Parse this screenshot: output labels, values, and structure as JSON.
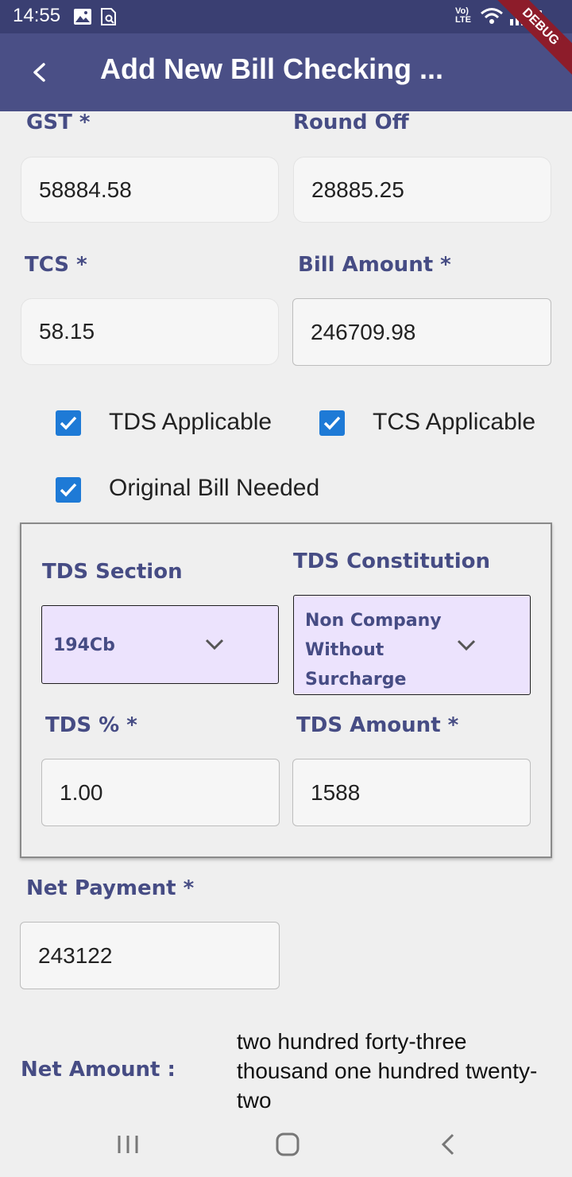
{
  "status_bar": {
    "time": "14:55",
    "network_label": "Vo) LTE"
  },
  "app_bar": {
    "title": "Add New Bill Checking ...",
    "debug_banner": "DEBUG"
  },
  "fields": {
    "gst": {
      "label": "GST *",
      "value": "58884.58"
    },
    "round_off": {
      "label": "Round Off",
      "value": "28885.25"
    },
    "tcs": {
      "label": "TCS *",
      "value": "58.15"
    },
    "bill_amount": {
      "label": "Bill Amount *",
      "value": "246709.98"
    }
  },
  "checkboxes": {
    "tds_applicable": {
      "label": "TDS Applicable",
      "checked": true
    },
    "tcs_applicable": {
      "label": "TCS Applicable",
      "checked": true
    },
    "original_bill": {
      "label": "Original Bill Needed",
      "checked": true
    }
  },
  "tds": {
    "section_label": "TDS Section",
    "section_value": "194Cb",
    "constitution_label": "TDS Constitution",
    "constitution_value": "Non Company Without Surcharge",
    "percent_label": "TDS % *",
    "percent_value": "1.00",
    "amount_label": "TDS Amount *",
    "amount_value": "1588"
  },
  "net_payment": {
    "label": "Net Payment *",
    "value": "243122"
  },
  "net_amount": {
    "label": "Net Amount :",
    "words": "two hundred forty-three thousand one hundred twenty-two"
  },
  "colors": {
    "primary": "#4a4f86",
    "label": "#464c84",
    "checkbox": "#1e7ad6",
    "dropdown_bg": "#ece3fd"
  }
}
